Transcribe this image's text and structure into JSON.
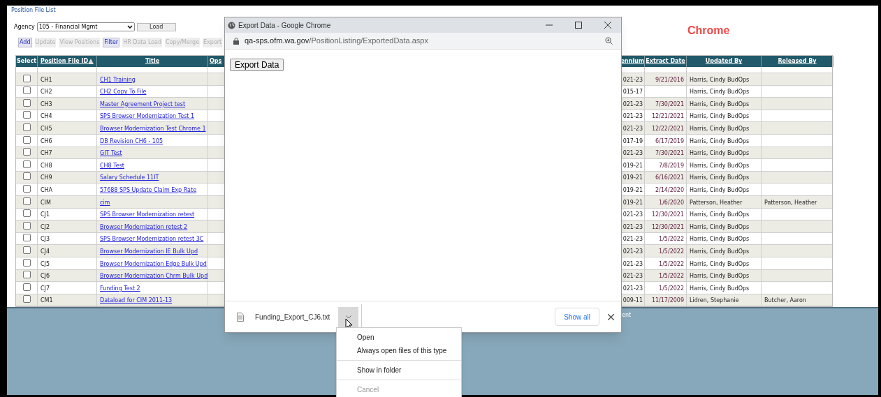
{
  "page": {
    "breadcrumb": "Position File List",
    "agency_label": "Agency",
    "agency_value": "105 - Financial Mgmt",
    "load_button": "Load",
    "browser_note": "Chrome",
    "footer_fragment": "ent"
  },
  "toolbar": [
    {
      "label": "Add",
      "disabled": false
    },
    {
      "label": "Update",
      "disabled": true
    },
    {
      "label": "View Positions",
      "disabled": true
    },
    {
      "label": "Filter",
      "disabled": false
    },
    {
      "label": "HR Data Load",
      "disabled": true
    },
    {
      "label": "Copy/Merge",
      "disabled": true
    },
    {
      "label": "Export",
      "disabled": true
    }
  ],
  "table": {
    "columns": {
      "select": "Select",
      "id": "Position File ID",
      "title": "Title",
      "ops": "Ops",
      "biennium": "ennium",
      "extract": "Extract Date",
      "updated": "Updated By",
      "released": "Released By"
    },
    "rows": [
      {
        "checked": false,
        "id": "CH1",
        "title": "CH1 Training",
        "biennium": "021-23",
        "extract": "9/21/2016",
        "updated": "Harris, Cindy BudOps",
        "released": ""
      },
      {
        "checked": false,
        "id": "CH2",
        "title": "CH2 Copy To File",
        "biennium": "015-17",
        "extract": "",
        "updated": "Harris, Cindy BudOps",
        "released": ""
      },
      {
        "checked": false,
        "id": "CH3",
        "title": "Master Agreement Project test",
        "biennium": "021-23",
        "extract": "7/30/2021",
        "updated": "Harris, Cindy BudOps",
        "released": ""
      },
      {
        "checked": false,
        "id": "CH4",
        "title": "SPS Browser Modernization Test 1",
        "biennium": "021-23",
        "extract": "12/21/2021",
        "updated": "Harris, Cindy BudOps",
        "released": ""
      },
      {
        "checked": false,
        "id": "CH5",
        "title": "Browser Modernization Test Chrome 1",
        "biennium": "021-23",
        "extract": "12/22/2021",
        "updated": "Harris, Cindy BudOps",
        "released": ""
      },
      {
        "checked": false,
        "id": "CH6",
        "title": "DB Revision CH6 - 105",
        "biennium": "017-19",
        "extract": "6/17/2019",
        "updated": "Harris, Cindy BudOps",
        "released": ""
      },
      {
        "checked": false,
        "id": "CH7",
        "title": "GIT Test",
        "biennium": "021-23",
        "extract": "7/30/2021",
        "updated": "Harris, Cindy BudOps",
        "released": ""
      },
      {
        "checked": false,
        "id": "CH8",
        "title": "CH8 Test",
        "biennium": "019-21",
        "extract": "7/8/2019",
        "updated": "Harris, Cindy BudOps",
        "released": ""
      },
      {
        "checked": false,
        "id": "CH9",
        "title": "Salary Schedule 11IT",
        "biennium": "019-21",
        "extract": "6/16/2021",
        "updated": "Harris, Cindy BudOps",
        "released": ""
      },
      {
        "checked": false,
        "id": "CHA",
        "title": "57688 SPS Update Claim Exp Rate",
        "biennium": "019-21",
        "extract": "2/14/2020",
        "updated": "Harris, Cindy BudOps",
        "released": ""
      },
      {
        "checked": false,
        "id": "CIM",
        "title": "cim",
        "biennium": "019-21",
        "extract": "1/6/2020",
        "updated": "Patterson, Heather",
        "released": "Patterson, Heather"
      },
      {
        "checked": false,
        "id": "CJ1",
        "title": "SPS Browser Modernization retest",
        "biennium": "021-23",
        "extract": "12/30/2021",
        "updated": "Harris, Cindy BudOps",
        "released": ""
      },
      {
        "checked": false,
        "id": "CJ2",
        "title": "Browser Modernization retest 2",
        "biennium": "021-23",
        "extract": "12/30/2021",
        "updated": "Harris, Cindy BudOps",
        "released": ""
      },
      {
        "checked": false,
        "id": "CJ3",
        "title": "SPS Browser Modernization retest 3C",
        "biennium": "021-23",
        "extract": "1/5/2022",
        "updated": "Harris, Cindy BudOps",
        "released": ""
      },
      {
        "checked": false,
        "id": "CJ4",
        "title": "Browser Modernization IE Bulk Upd",
        "biennium": "021-23",
        "extract": "1/5/2022",
        "updated": "Harris, Cindy BudOps",
        "released": ""
      },
      {
        "checked": false,
        "id": "CJ5",
        "title": "Browser Modernization Edge Bulk Upd",
        "biennium": "021-23",
        "extract": "1/5/2022",
        "updated": "Harris, Cindy BudOps",
        "released": ""
      },
      {
        "checked": false,
        "id": "CJ6",
        "title": "Browser Modernization Chrm Bulk Upd",
        "biennium": "021-23",
        "extract": "1/5/2022",
        "updated": "Harris, Cindy BudOps",
        "released": ""
      },
      {
        "checked": false,
        "id": "CJ7",
        "title": "Funding Test 2",
        "biennium": "021-23",
        "extract": "1/5/2022",
        "updated": "Harris, Cindy BudOps",
        "released": ""
      },
      {
        "checked": false,
        "id": "CM1",
        "title": "Dataload for CIM 2011-13",
        "biennium": "009-11",
        "extract": "11/17/2009",
        "updated": "Lidren, Stephanie",
        "released": "Butcher, Aaron"
      }
    ]
  },
  "popup": {
    "title": "Export Data - Google Chrome",
    "url_host": "qa-sps.ofm.wa.gov",
    "url_path": "/PositionListing/ExportedData.aspx",
    "export_button": "Export Data",
    "download_file": "Funding_Export_CJ6.txt",
    "show_all": "Show all"
  },
  "menu": [
    {
      "label": "Open",
      "disabled": false,
      "divider_after": false
    },
    {
      "label": "Always open files of this type",
      "disabled": false,
      "divider_after": true
    },
    {
      "label": "Show in folder",
      "disabled": false,
      "divider_after": true
    },
    {
      "label": "Cancel",
      "disabled": true,
      "divider_after": false
    }
  ]
}
